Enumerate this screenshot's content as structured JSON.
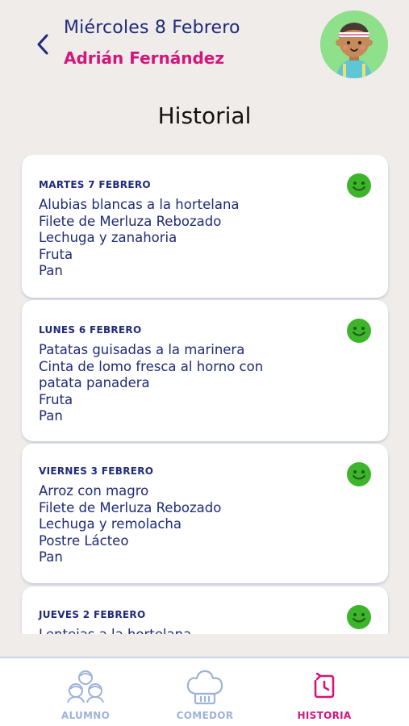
{
  "header": {
    "date": "Miércoles 8 Febrero",
    "student_name": "Adrián Fernández"
  },
  "page_title": "Historial",
  "history": [
    {
      "date": "MARTES 7 FEBRERO",
      "items": [
        "Alubias blancas a la hortelana",
        "Filete de Merluza Rebozado",
        "Lechuga y zanahoria",
        "Fruta",
        "Pan"
      ],
      "rating_icon": "happy-face-icon"
    },
    {
      "date": "LUNES 6 FEBRERO",
      "items": [
        "Patatas guisadas a la marinera",
        "Cinta de lomo fresca al horno con",
        "patata panadera",
        "Fruta",
        "Pan"
      ],
      "rating_icon": "happy-face-icon"
    },
    {
      "date": "VIERNES 3 FEBRERO",
      "items": [
        "Arroz con magro",
        "Filete de Merluza Rebozado",
        "Lechuga y remolacha",
        "Postre Lácteo",
        "Pan"
      ],
      "rating_icon": "happy-face-icon"
    },
    {
      "date": "JUEVES 2 FEBRERO",
      "items": [
        "Lentejas a la hortelana"
      ],
      "rating_icon": "happy-face-icon"
    }
  ],
  "nav": {
    "alumno": "ALUMNO",
    "comedor": "COMEDOR",
    "historia": "HISTORIA"
  },
  "colors": {
    "navy": "#1f2a7a",
    "magenta": "#d3157c",
    "smiley_green": "#3cb52b",
    "nav_inactive": "#9fb2d9",
    "background": "#efecea"
  }
}
